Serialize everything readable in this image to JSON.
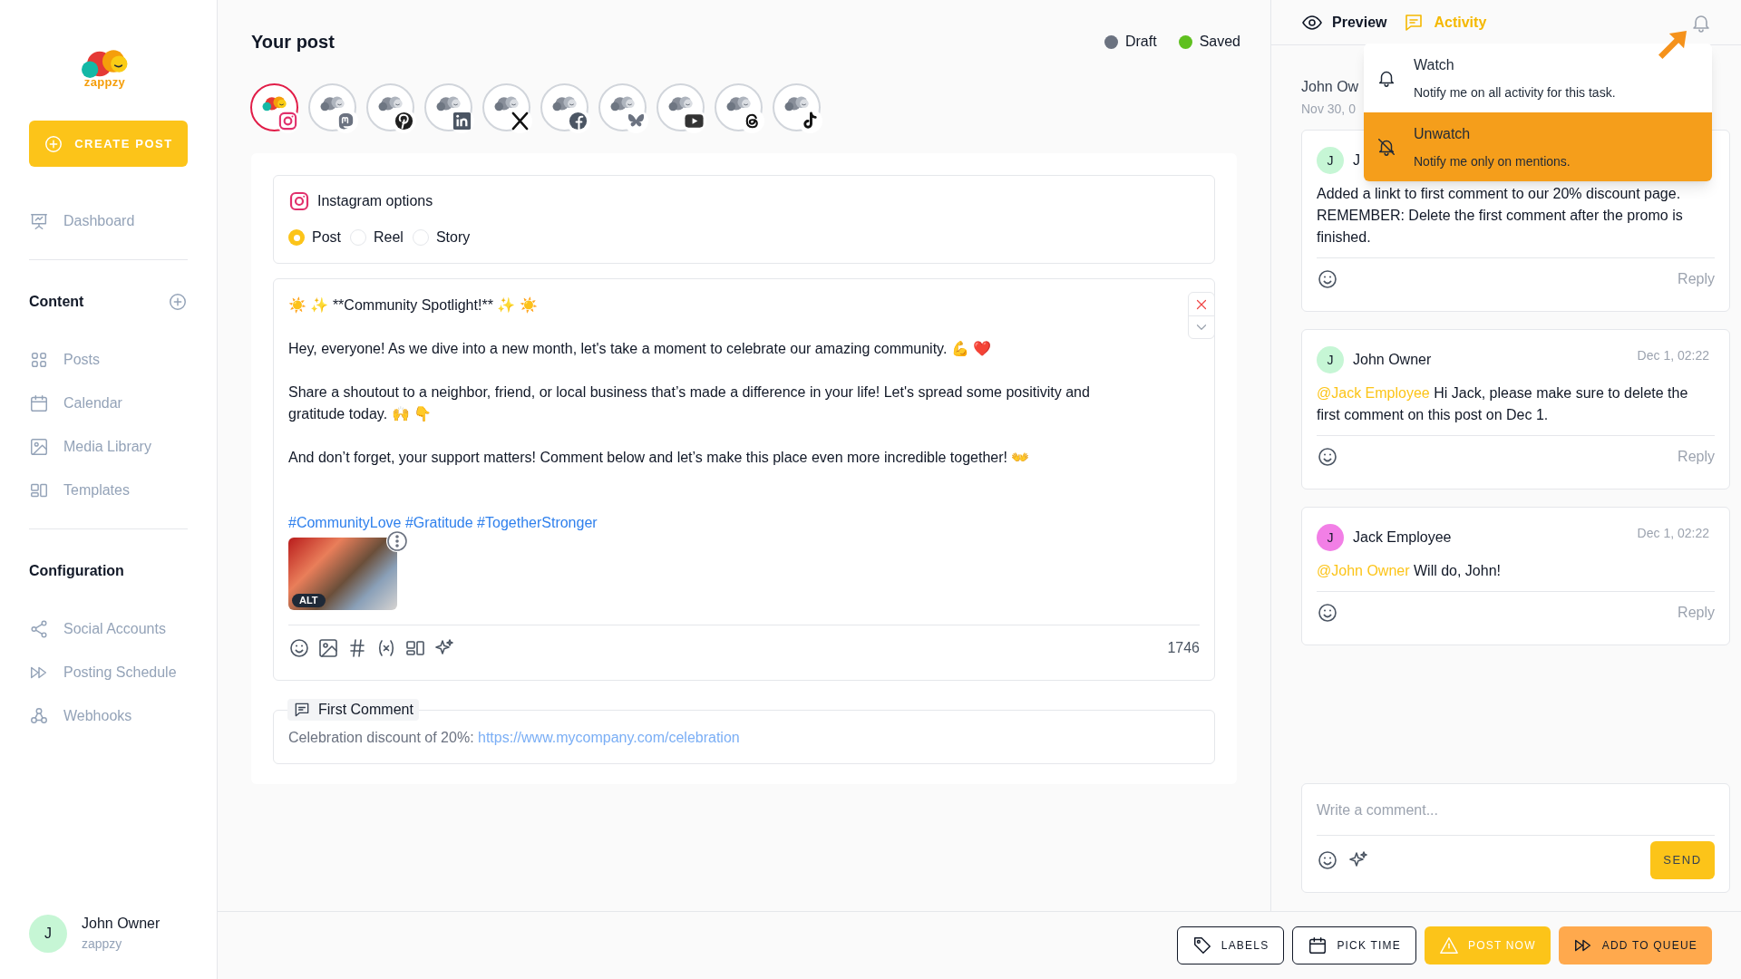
{
  "sidebar": {
    "logo_text": "zappzy",
    "create_button": "CREATE POST",
    "nav": [
      {
        "label": "Dashboard"
      }
    ],
    "sections": [
      {
        "title": "Content",
        "has_add": true,
        "items": [
          {
            "label": "Posts"
          },
          {
            "label": "Calendar"
          },
          {
            "label": "Media Library"
          },
          {
            "label": "Templates"
          }
        ]
      },
      {
        "title": "Configuration",
        "has_add": false,
        "items": [
          {
            "label": "Social Accounts"
          },
          {
            "label": "Posting Schedule"
          },
          {
            "label": "Webhooks"
          }
        ]
      }
    ],
    "user": {
      "initial": "J",
      "name": "John Owner",
      "org": "zappzy"
    }
  },
  "post": {
    "title": "Your post",
    "statuses": [
      {
        "label": "Draft",
        "color": "#6b7280"
      },
      {
        "label": "Saved",
        "color": "#5fc01f"
      }
    ],
    "accounts": [
      {
        "kind": "instagram",
        "selected": true
      },
      {
        "kind": "mastodon",
        "selected": false
      },
      {
        "kind": "pinterest",
        "selected": false
      },
      {
        "kind": "linkedin",
        "selected": false
      },
      {
        "kind": "x",
        "selected": false
      },
      {
        "kind": "facebook",
        "selected": false
      },
      {
        "kind": "bluesky",
        "selected": false
      },
      {
        "kind": "youtube",
        "selected": false
      },
      {
        "kind": "threads",
        "selected": false
      },
      {
        "kind": "tiktok",
        "selected": false
      }
    ],
    "options": {
      "title": "Instagram options",
      "types": [
        {
          "label": "Post",
          "selected": true
        },
        {
          "label": "Reel",
          "selected": false
        },
        {
          "label": "Story",
          "selected": false
        }
      ]
    },
    "editor": {
      "paragraphs": [
        "☀️ ✨ **Community Spotlight!** ✨ ☀️",
        "Hey, everyone! As we dive into a new month, let's take a moment to celebrate our amazing community. 💪 ❤️",
        "Share a shoutout to a neighbor, friend, or local business that’s made a difference in your life! Let's spread some positivity and gratitude today. 🙌 👇",
        "And don’t forget, your support matters! Comment below and let’s make this place even more incredible together! 👐"
      ],
      "hashtags": "#CommunityLove #Gratitude #TogetherStronger",
      "attachment_badge": "ALT",
      "counter": "1746"
    },
    "first_comment": {
      "label": "First Comment",
      "text": "Celebration discount of 20%: ",
      "link": "https://www.mycompany.com/celebration"
    }
  },
  "activity": {
    "tabs": [
      {
        "label": "Preview",
        "selected": false
      },
      {
        "label": "Activity",
        "selected": true
      }
    ],
    "entry_author": "John Ow",
    "entry_date": "Nov 30, 0",
    "watch_menu": [
      {
        "title": "Watch",
        "description": "Notify me on all activity for this task.",
        "selected": false
      },
      {
        "title": "Unwatch",
        "description": "Notify me only on mentions.",
        "selected": true
      }
    ],
    "comments": [
      {
        "initial": "J",
        "author": "J",
        "color": "#c6f6d5",
        "body": "Added a linkt to first comment to our 20% discount page. REMEMBER: Delete the first comment after the promo is finished.",
        "reply": "Reply"
      },
      {
        "initial": "J",
        "author": "John Owner",
        "color": "#c6f6d5",
        "time": "Dec 1, 02:22",
        "mention": "@Jack Employee",
        "body": "Hi Jack, please make sure to delete the first comment on this post on Dec 1.",
        "reply": "Reply"
      },
      {
        "initial": "J",
        "author": "Jack Employee",
        "color": "#f27fe6",
        "time": "Dec 1, 02:22",
        "mention": "@John Owner",
        "body": "Will do, John!",
        "reply": "Reply"
      }
    ],
    "composer": {
      "placeholder": "Write a comment...",
      "send": "SEND"
    }
  },
  "footer": {
    "buttons": [
      {
        "label": "LABELS",
        "kind": "outline"
      },
      {
        "label": "PICK TIME",
        "kind": "outline"
      },
      {
        "label": "POST NOW",
        "kind": "primary"
      },
      {
        "label": "ADD TO QUEUE",
        "kind": "accent"
      }
    ]
  }
}
